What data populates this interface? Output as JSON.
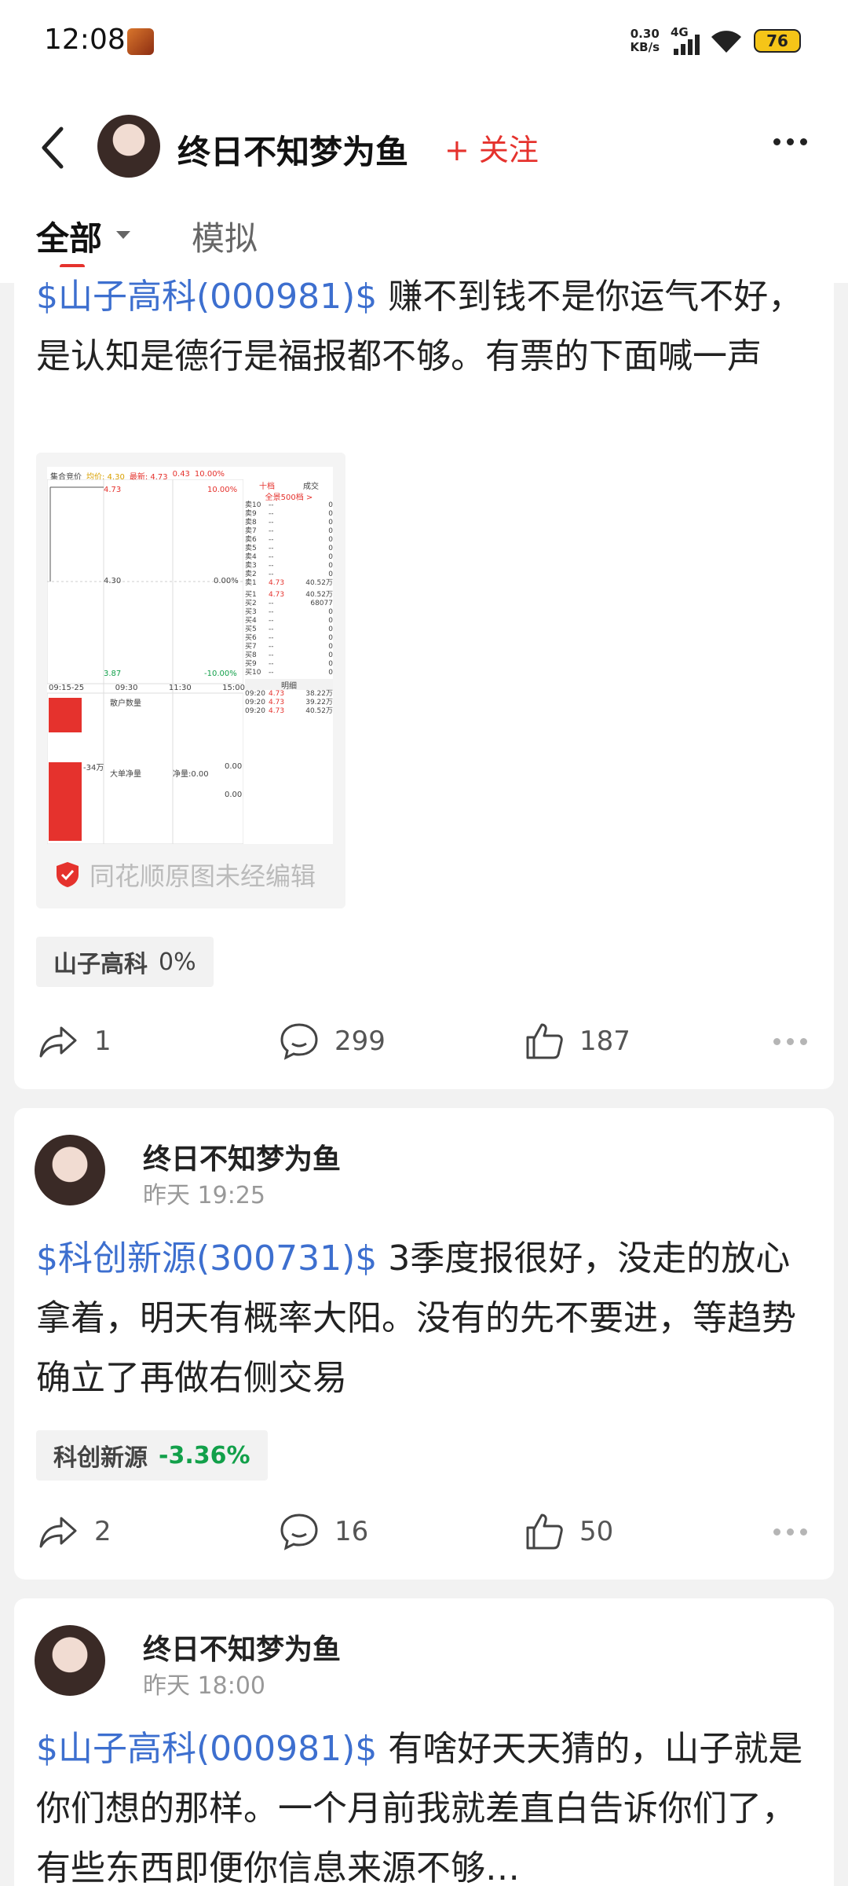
{
  "status": {
    "time": "12:08",
    "net_speed_value": "0.30",
    "net_speed_unit": "KB/s",
    "network": "4G",
    "battery": "76"
  },
  "header": {
    "name": "终日不知梦为鱼",
    "follow": "关注"
  },
  "tabs": {
    "all": "全部",
    "sim": "模拟"
  },
  "posts": [
    {
      "stock_link": "$山子高科(000981)$",
      "text": " 赚不到钱不是你运气不好，是认知是德行是福报都不够。有票的下面喊一声",
      "screenshot": {
        "header": [
          "集合竞价",
          "均价: 4.30",
          "最新: 4.73",
          "0.43",
          "10.00%"
        ],
        "price_top": "4.73",
        "price_mid": "4.30",
        "price_low": "3.87",
        "pct_top": "10.00%",
        "pct_mid": "0.00%",
        "pct_low": "-10.00%",
        "times": [
          "09:15-25",
          "09:30",
          "11:30",
          "15:00"
        ],
        "book_tab": "十档",
        "book_tab2": "成交",
        "book_full": "全景500档 >",
        "asks": [
          "卖10",
          "卖9",
          "卖8",
          "卖7",
          "卖6",
          "卖5",
          "卖4",
          "卖3",
          "卖2",
          "卖1"
        ],
        "bids": [
          "买1",
          "买2",
          "买3",
          "买4",
          "买5",
          "买6",
          "买7",
          "买8",
          "买9",
          "买10"
        ],
        "ask1_price": "4.73",
        "ask1_vol": "40.52万",
        "bid1_price": "4.73",
        "bid1_vol": "40.52万",
        "bid2_vol": "68077",
        "dash": "--",
        "zero": "0",
        "sub1": "散户数量",
        "sub2": "大单净量",
        "sub3": "净量:0.00",
        "axis_left": "-34万",
        "axis_zero1": "0.00",
        "axis_zero2": "0.00",
        "detail": "明细",
        "trades": [
          [
            "09:20",
            "4.73",
            "38.22万"
          ],
          [
            "09:20",
            "4.73",
            "39.22万"
          ],
          [
            "09:20",
            "4.73",
            "40.52万"
          ]
        ]
      },
      "badge": "同花顺原图未经编辑",
      "tag_name": "山子高科",
      "tag_pct": "0%",
      "shares": "1",
      "comments": "299",
      "likes": "187"
    },
    {
      "author": "终日不知梦为鱼",
      "time": "昨天 19:25",
      "stock_link": "$科创新源(300731)$",
      "text": " 3季度报很好，没走的放心拿着，明天有概率大阳。没有的先不要进，等趋势确立了再做右侧交易",
      "tag_name": "科创新源",
      "tag_pct": "-3.36%",
      "shares": "2",
      "comments": "16",
      "likes": "50"
    },
    {
      "author": "终日不知梦为鱼",
      "time": "昨天 18:00",
      "stock_link": "$山子高科(000981)$",
      "text": " 有啥好天天猜的，山子就是你们想的那样。一个月前我就差直白告诉你们了，有些东西即便你信息来源不够…"
    }
  ]
}
